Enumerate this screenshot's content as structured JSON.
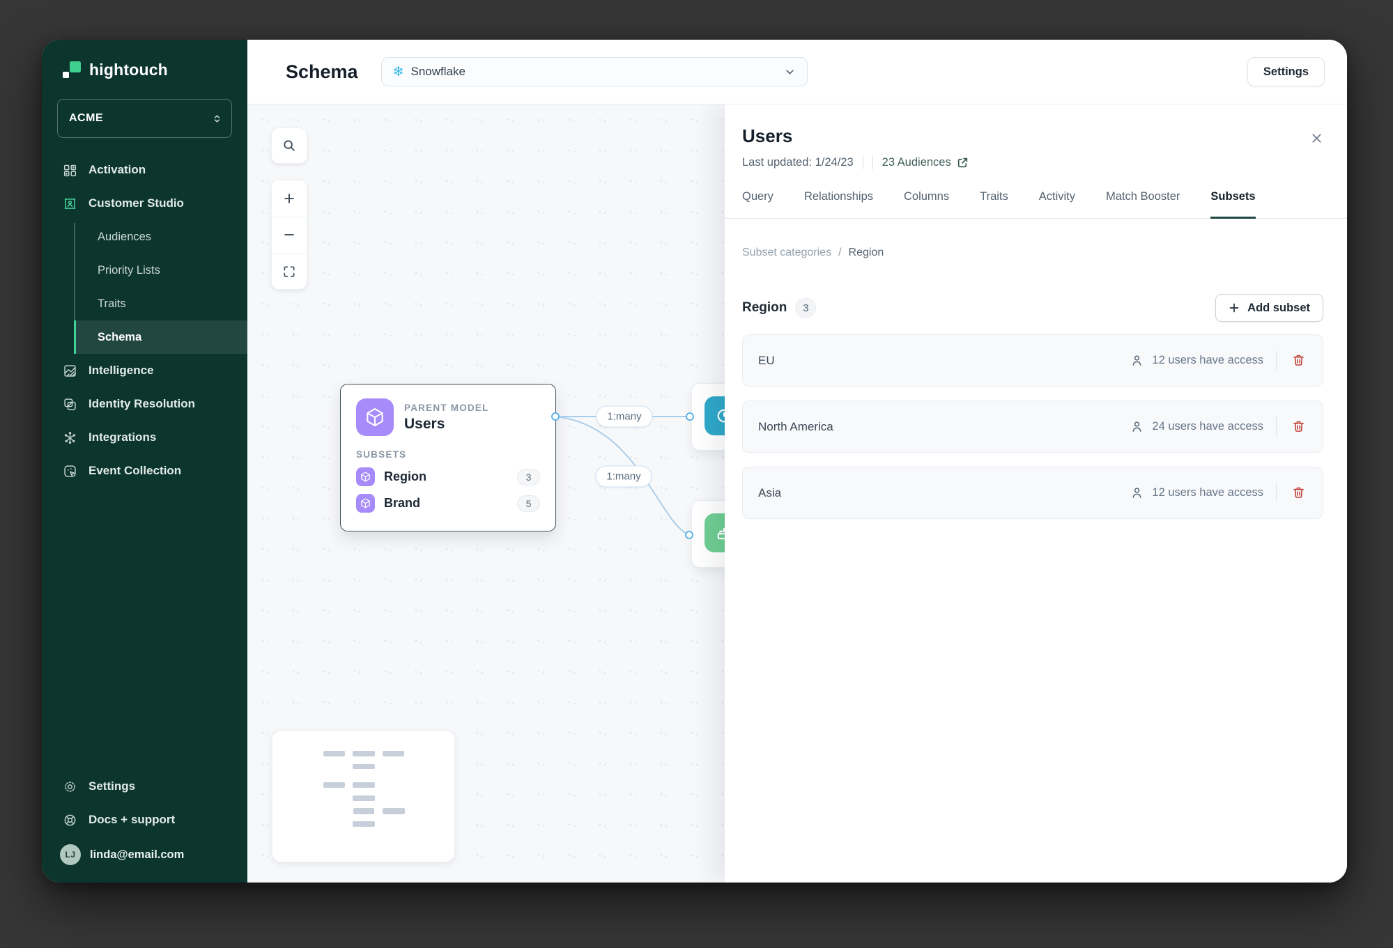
{
  "brand": {
    "name": "hightouch"
  },
  "workspace": {
    "name": "ACME"
  },
  "sidebar": {
    "items": [
      {
        "label": "Activation",
        "icon": "activation-icon"
      },
      {
        "label": "Customer Studio",
        "icon": "customer-studio-icon"
      },
      {
        "label": "Intelligence",
        "icon": "intelligence-icon"
      },
      {
        "label": "Identity Resolution",
        "icon": "identity-resolution-icon"
      },
      {
        "label": "Integrations",
        "icon": "integrations-icon"
      },
      {
        "label": "Event Collection",
        "icon": "event-collection-icon"
      }
    ],
    "customer_studio_children": [
      {
        "label": "Audiences"
      },
      {
        "label": "Priority Lists"
      },
      {
        "label": "Traits"
      },
      {
        "label": "Schema",
        "active": true
      }
    ],
    "footer": [
      {
        "label": "Settings",
        "icon": "gear-icon"
      },
      {
        "label": "Docs + support",
        "icon": "lifebuoy-icon"
      }
    ],
    "user": {
      "initials": "LJ",
      "email": "linda@email.com"
    }
  },
  "topbar": {
    "title": "Schema",
    "source_selector": {
      "value": "Snowflake",
      "icon": "snowflake-icon",
      "glyph": "❄"
    },
    "settings_button": "Settings"
  },
  "canvas": {
    "controls": {
      "zoom_in": "+",
      "zoom_out": "−"
    },
    "parent_node": {
      "kind_label": "PARENT MODEL",
      "title": "Users",
      "subsets_label": "SUBSETS",
      "subsets": [
        {
          "name": "Region",
          "count": "3"
        },
        {
          "name": "Brand",
          "count": "5"
        }
      ]
    },
    "edges": [
      {
        "label": "1:many"
      },
      {
        "label": "1:many"
      }
    ]
  },
  "panel": {
    "title": "Users",
    "meta": {
      "last_updated": "Last updated: 1/24/23",
      "audiences_link": "23 Audiences"
    },
    "tabs": [
      {
        "label": "Query"
      },
      {
        "label": "Relationships"
      },
      {
        "label": "Columns"
      },
      {
        "label": "Traits"
      },
      {
        "label": "Activity"
      },
      {
        "label": "Match Booster"
      },
      {
        "label": "Subsets",
        "active": true
      }
    ],
    "breadcrumb": {
      "parent": "Subset categories",
      "separator": "/",
      "current": "Region"
    },
    "section": {
      "title": "Region",
      "count": "3",
      "add_button_label": "Add subset"
    },
    "subsets": [
      {
        "name": "EU",
        "access": "12 users have access"
      },
      {
        "name": "North America",
        "access": "24 users have access"
      },
      {
        "name": "Asia",
        "access": "12 users have access"
      }
    ]
  },
  "colors": {
    "sidebar_bg": "#0C352E",
    "accent_green": "#3FD598",
    "snowflake_blue": "#29B5E8",
    "node_purple": "#A78BFA",
    "edge_blue": "#A9CFEC",
    "teal_node": "#2FA8C9",
    "green_node": "#6FCE93",
    "danger_red": "#BF4036"
  }
}
